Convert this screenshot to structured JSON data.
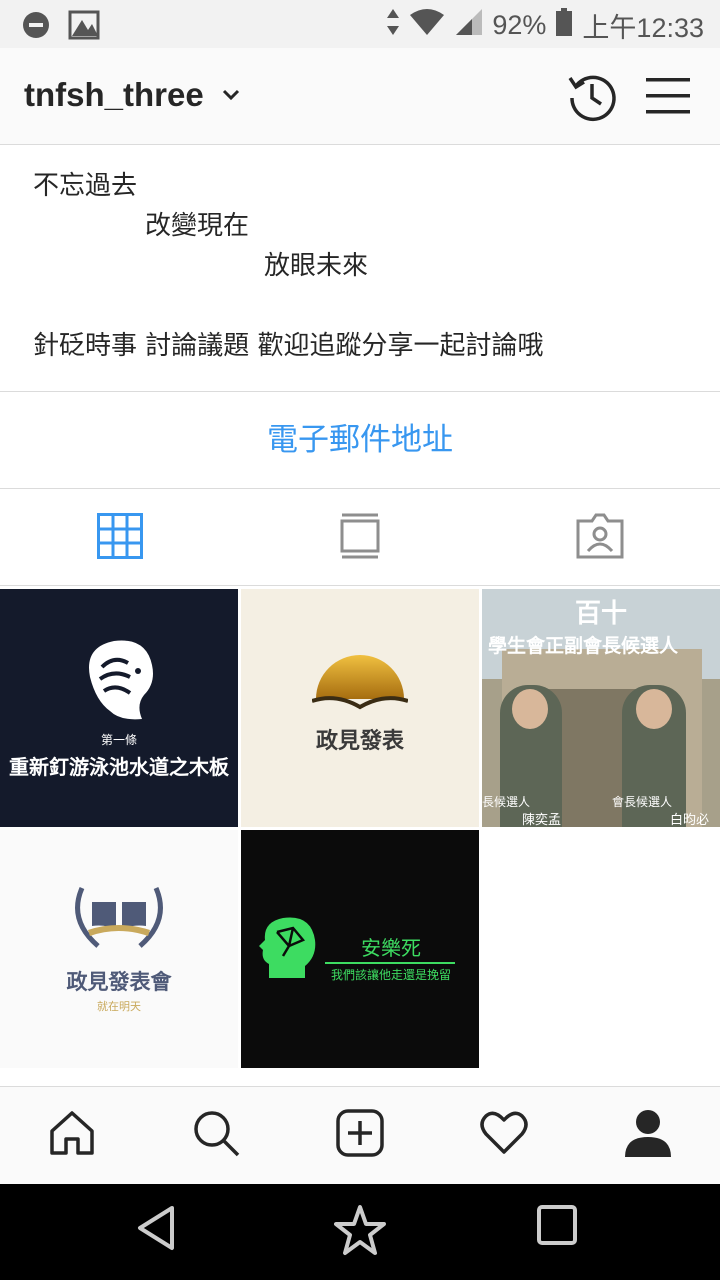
{
  "status_bar": {
    "battery": "92%",
    "time": "上午12:33"
  },
  "header": {
    "username": "tnfsh_three"
  },
  "bio": {
    "lines": [
      "不忘過去",
      "改變現在",
      "放眼未來"
    ],
    "description": "針砭時事 討論議題 歡迎追蹤分享一起討論哦"
  },
  "email_link": "電子郵件地址",
  "tabs": [
    "grid",
    "feed",
    "tagged"
  ],
  "posts": {
    "post1": {
      "small": "第一條",
      "title": "重新釘游泳池水道之木板"
    },
    "post2": {
      "title": "政見發表"
    },
    "post3": {
      "number": "百十",
      "title": "學生會正副會長候選人",
      "left_role": "長候選人",
      "left_name": "陳奕孟",
      "right_role": "會長候選人",
      "right_name": "白昀必"
    },
    "post4": {
      "title": "政見發表會",
      "subtitle": "就在明天"
    },
    "post5": {
      "title": "安樂死",
      "subtitle": "我們該讓他走還是挽留"
    }
  },
  "colors": {
    "link": "#3897f0",
    "grid_active": "#3897f0",
    "euthanasia_green": "#3ddc61"
  }
}
